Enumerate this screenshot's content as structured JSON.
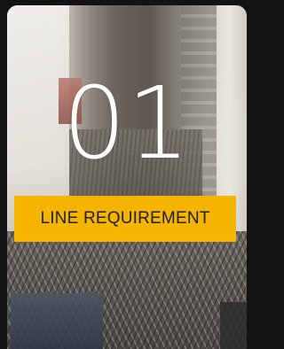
{
  "card": {
    "number": "01",
    "label": "LINE REQUIREMENT"
  },
  "colors": {
    "background": "#121212",
    "label_background": "#f4b400",
    "label_text": "#1f1f1f",
    "number_text": "#ffffff"
  }
}
